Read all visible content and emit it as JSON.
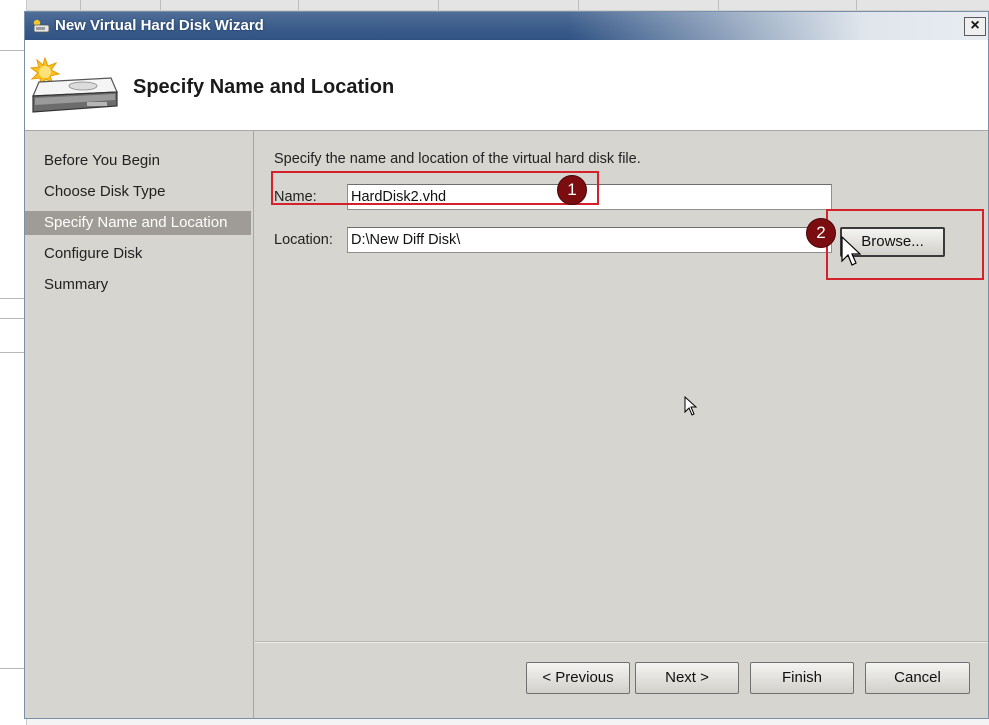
{
  "window": {
    "title": "New Virtual Hard Disk Wizard",
    "close_label": "×"
  },
  "header": {
    "title": "Specify Name and Location"
  },
  "sidebar": {
    "items": [
      {
        "label": "Before You Begin",
        "selected": false
      },
      {
        "label": "Choose Disk Type",
        "selected": false
      },
      {
        "label": "Specify Name and Location",
        "selected": true
      },
      {
        "label": "Configure Disk",
        "selected": false
      },
      {
        "label": "Summary",
        "selected": false
      }
    ]
  },
  "content": {
    "instruction": "Specify the name and location of the virtual hard disk file.",
    "name_label": "Name:",
    "name_value": "HardDisk2.vhd",
    "location_label": "Location:",
    "location_value": "D:\\New Diff Disk\\",
    "browse_label": "Browse..."
  },
  "footer": {
    "previous_label": "< Previous",
    "next_label": "Next >",
    "finish_label": "Finish",
    "cancel_label": "Cancel"
  },
  "annotations": {
    "step1": "1",
    "step2": "2",
    "color": "#d4212b",
    "badge_color": "#7b0d10"
  },
  "colors": {
    "titlebar": "#3d5e8c",
    "dialog_bg": "#d7d5d0",
    "selected_nav": "#9f9c97"
  }
}
